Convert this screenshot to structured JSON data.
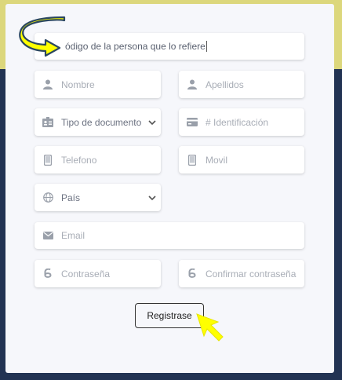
{
  "form": {
    "referrer_value": "ódigo de la persona que lo refiere",
    "first_name_placeholder": "Nombre",
    "last_name_placeholder": "Apellidos",
    "doc_type_value": "Tipo de documento",
    "id_number_placeholder": "# Identificación",
    "phone_placeholder": "Telefono",
    "mobile_placeholder": "Movil",
    "country_value": "País",
    "email_placeholder": "Email",
    "password_placeholder": "Contraseña",
    "confirm_password_placeholder": "Confirmar contraseña",
    "submit_label": "Registrase"
  },
  "colors": {
    "top_band": "#dcd77c",
    "page_background": "#223353",
    "card": "#f6f7fb",
    "highlight_arrow": "#ffff00"
  },
  "icons": [
    "user-icon",
    "id-card-icon",
    "chevron-down-icon",
    "phone-icon",
    "globe-icon",
    "email-icon",
    "lock-digit-icon",
    "curved-arrow-icon",
    "pointer-arrow-icon"
  ]
}
